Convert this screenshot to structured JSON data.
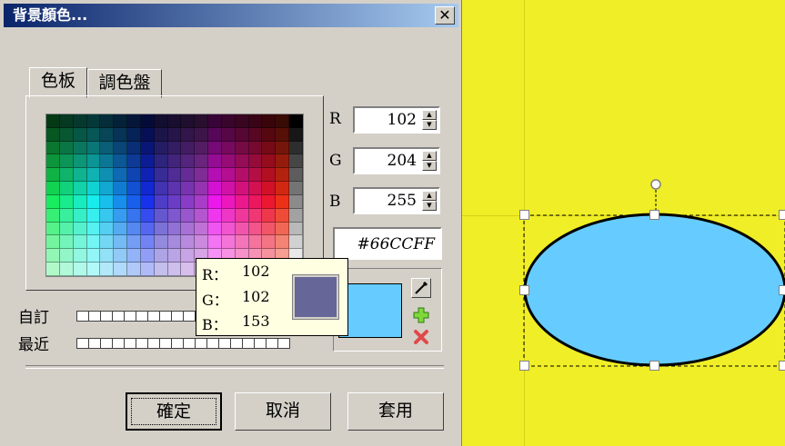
{
  "dialog": {
    "title": "背景顏色...",
    "close_glyph": "✕",
    "tabs": [
      {
        "label": "色板"
      },
      {
        "label": "調色盤"
      }
    ],
    "rgb": [
      {
        "label": "R",
        "value": "102"
      },
      {
        "label": "G",
        "value": "204"
      },
      {
        "label": "B",
        "value": "255"
      }
    ],
    "hex": "#66CCFF",
    "preview_color": "#66ccff",
    "custom_label": "自訂",
    "recent_label": "最近",
    "buttons": {
      "ok": "確定",
      "cancel": "取消",
      "apply": "套用"
    },
    "icons": {
      "eyedropper": "eyedropper-icon",
      "add": "plus-icon",
      "delete": "x-icon"
    }
  },
  "tooltip": {
    "r_label": "R：",
    "r_value": "102",
    "g_label": "G：",
    "g_value": "102",
    "b_label": "B：",
    "b_value": "153",
    "swatch_color": "#666699"
  },
  "canvas": {
    "background": "#f0ee26",
    "ellipse_fill": "#66ccff",
    "ellipse_stroke": "#000000"
  }
}
